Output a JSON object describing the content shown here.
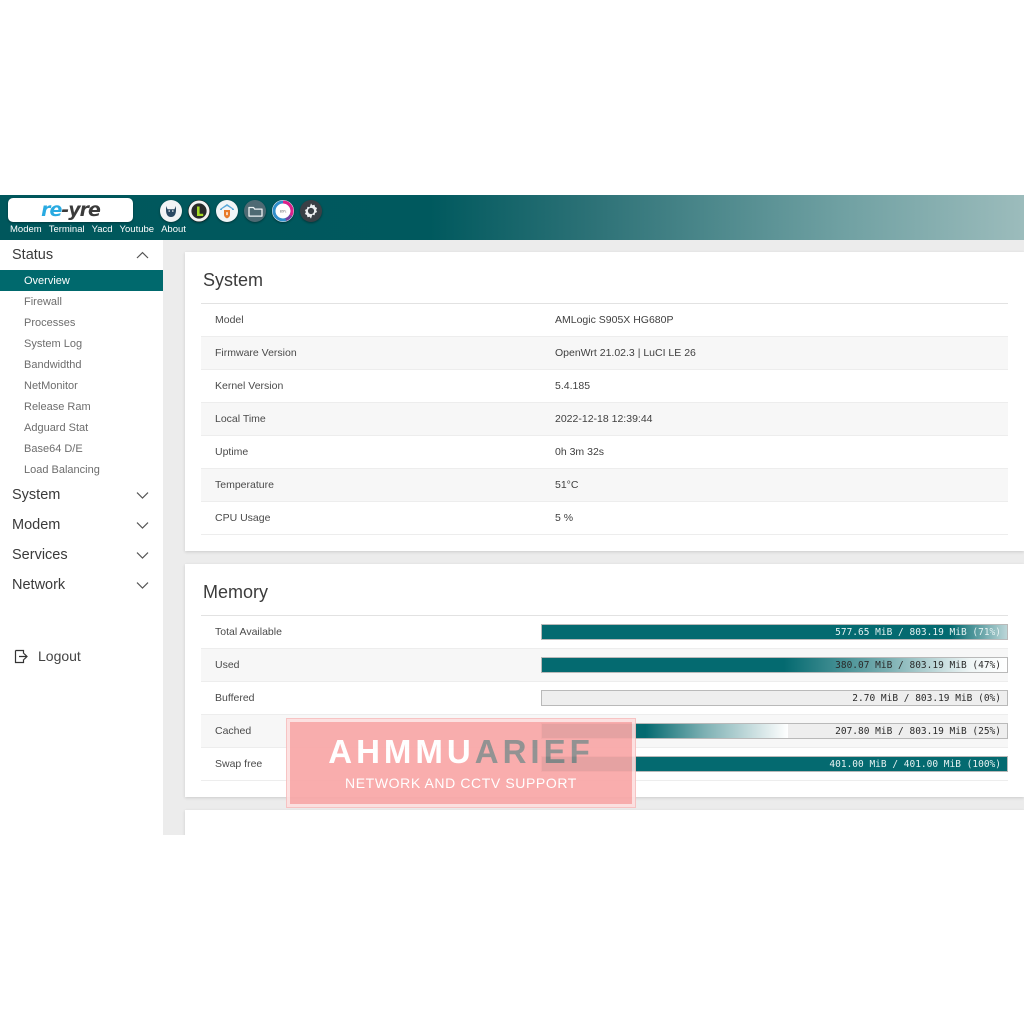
{
  "header": {
    "logo": {
      "part1": "re",
      "part2": "-yre"
    },
    "nav": [
      {
        "label": "Modem"
      },
      {
        "label": "Terminal"
      },
      {
        "label": "Yacd"
      },
      {
        "label": "Youtube"
      },
      {
        "label": "About"
      }
    ],
    "icons": [
      {
        "name": "cat-icon",
        "title": "Cat"
      },
      {
        "name": "luci-l-icon",
        "title": "L"
      },
      {
        "name": "adguard-home-icon",
        "title": "AdGuard Home"
      },
      {
        "name": "folder-icon",
        "title": "File Browser"
      },
      {
        "name": "disk-usage-icon",
        "title": "Disk Usage"
      },
      {
        "name": "gear-icon",
        "title": "Settings"
      }
    ],
    "colors": {
      "gradient_start": "#00575c",
      "gradient_end": "#9cbcbc"
    }
  },
  "sidebar": {
    "groups": [
      {
        "label": "Status",
        "expanded": true,
        "items": [
          {
            "label": "Overview",
            "active": true
          },
          {
            "label": "Firewall",
            "active": false
          },
          {
            "label": "Processes",
            "active": false
          },
          {
            "label": "System Log",
            "active": false
          },
          {
            "label": "Bandwidthd",
            "active": false
          },
          {
            "label": "NetMonitor",
            "active": false
          },
          {
            "label": "Release Ram",
            "active": false
          },
          {
            "label": "Adguard Stat",
            "active": false
          },
          {
            "label": "Base64 D/E",
            "active": false
          },
          {
            "label": "Load Balancing",
            "active": false
          }
        ]
      },
      {
        "label": "System",
        "expanded": false,
        "items": []
      },
      {
        "label": "Modem",
        "expanded": false,
        "items": []
      },
      {
        "label": "Services",
        "expanded": false,
        "items": []
      },
      {
        "label": "Network",
        "expanded": false,
        "items": []
      }
    ],
    "logout_label": "Logout",
    "active_color": "#00696d"
  },
  "system_card": {
    "title": "System",
    "rows": [
      {
        "key": "Model",
        "value": "AMLogic S905X HG680P"
      },
      {
        "key": "Firmware Version",
        "value": "OpenWrt 21.02.3 | LuCI LE 26"
      },
      {
        "key": "Kernel Version",
        "value": "5.4.185"
      },
      {
        "key": "Local Time",
        "value": "2022-12-18 12:39:44"
      },
      {
        "key": "Uptime",
        "value": "0h 3m 32s"
      },
      {
        "key": "Temperature",
        "value": "51°C"
      },
      {
        "key": "CPU Usage",
        "value": "5 %"
      }
    ]
  },
  "memory_card": {
    "title": "Memory",
    "rows": [
      {
        "key": "Total Available",
        "label": "577.65 MiB / 803.19 MiB (71%)",
        "percent": 71,
        "filled": true
      },
      {
        "key": "Used",
        "label": "380.07 MiB / 803.19 MiB (47%)",
        "percent": 47,
        "filled": true
      },
      {
        "key": "Buffered",
        "label": "2.70 MiB / 803.19 MiB (0%)",
        "percent": 0,
        "filled": false
      },
      {
        "key": "Cached",
        "label": "207.80 MiB / 803.19 MiB (25%)",
        "percent": 25,
        "filled": true
      },
      {
        "key": "Swap free",
        "label": "401.00 MiB / 401.00 MiB (100%)",
        "percent": 100,
        "filled": true
      }
    ],
    "bar_color": "#046a70"
  },
  "watermark": {
    "main_white": "AHMMU",
    "main_gray": "ARIEF",
    "subtitle": "NETWORK  AND CCTV SUPPORT",
    "color": "#f9a7a7"
  }
}
